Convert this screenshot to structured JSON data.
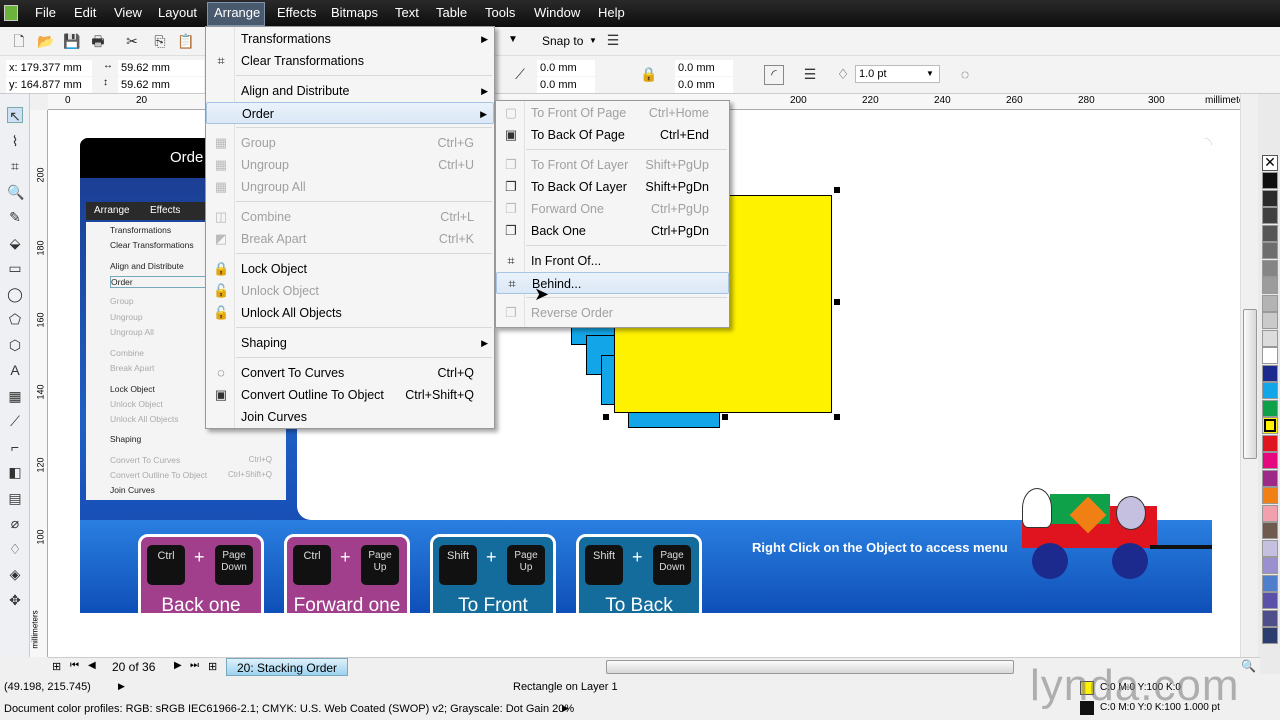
{
  "menubar": {
    "items": [
      "File",
      "Edit",
      "View",
      "Layout",
      "Arrange",
      "Effects",
      "Bitmaps",
      "Text",
      "Table",
      "Tools",
      "Window",
      "Help"
    ]
  },
  "toolbar": {
    "snap_to": "Snap to"
  },
  "property_bar": {
    "x": "x: 179.377 mm",
    "y": "y: 164.877 mm",
    "width": "59.62 mm",
    "height": "59.62 mm",
    "corner1": "0.0 mm",
    "corner2": "0.0 mm",
    "corner3": "0.0 mm",
    "corner4": "0.0 mm",
    "outline_width": "1.0 pt"
  },
  "ruler": {
    "h_ticks": [
      "0",
      "20",
      "200",
      "220",
      "240",
      "260",
      "280",
      "300"
    ],
    "unit": "millimeters",
    "v_ticks": [
      "200",
      "180",
      "160",
      "140",
      "120",
      "100"
    ],
    "v_unit": "millimeters"
  },
  "arrange_menu": [
    {
      "label": "Transformations",
      "arrow": true,
      "icon": ""
    },
    {
      "label": "Clear Transformations",
      "icon": "⌗"
    },
    {
      "sep": true
    },
    {
      "label": "Align and Distribute",
      "arrow": true
    },
    {
      "label": "Order",
      "arrow": true,
      "hl": true
    },
    {
      "sep": true
    },
    {
      "label": "Group",
      "shortcut": "Ctrl+G",
      "dis": true,
      "icon": "▦"
    },
    {
      "label": "Ungroup",
      "shortcut": "Ctrl+U",
      "dis": true,
      "icon": "▦"
    },
    {
      "label": "Ungroup All",
      "dis": true,
      "icon": "▦"
    },
    {
      "sep": true
    },
    {
      "label": "Combine",
      "shortcut": "Ctrl+L",
      "dis": true,
      "icon": "◫"
    },
    {
      "label": "Break Apart",
      "shortcut": "Ctrl+K",
      "dis": true,
      "icon": "◩"
    },
    {
      "sep": true
    },
    {
      "label": "Lock Object",
      "icon": "🔒"
    },
    {
      "label": "Unlock Object",
      "dis": true,
      "icon": "🔓"
    },
    {
      "label": "Unlock All Objects",
      "icon": "🔓"
    },
    {
      "sep": true
    },
    {
      "label": "Shaping",
      "arrow": true
    },
    {
      "sep": true
    },
    {
      "label": "Convert To Curves",
      "shortcut": "Ctrl+Q",
      "icon": "◌"
    },
    {
      "label": "Convert Outline To Object",
      "shortcut": "Ctrl+Shift+Q",
      "icon": "▣"
    },
    {
      "label": "Join Curves"
    }
  ],
  "order_menu": [
    {
      "label": "To Front Of Page",
      "shortcut": "Ctrl+Home",
      "dis": true,
      "icon": "▢"
    },
    {
      "label": "To Back Of Page",
      "shortcut": "Ctrl+End",
      "icon": "▣"
    },
    {
      "sep": true
    },
    {
      "label": "To Front Of Layer",
      "shortcut": "Shift+PgUp",
      "dis": true,
      "icon": "❐"
    },
    {
      "label": "To Back Of Layer",
      "shortcut": "Shift+PgDn",
      "icon": "❐"
    },
    {
      "label": "Forward One",
      "shortcut": "Ctrl+PgUp",
      "dis": true,
      "icon": "❐"
    },
    {
      "label": "Back One",
      "shortcut": "Ctrl+PgDn",
      "icon": "❐"
    },
    {
      "sep": true
    },
    {
      "label": "In Front Of...",
      "icon": "⌗"
    },
    {
      "label": "Behind...",
      "hl": true,
      "icon": "⌗"
    },
    {
      "sep": true
    },
    {
      "label": "Reverse Order",
      "dis": true,
      "icon": "❐"
    }
  ],
  "slide": {
    "title": "Orde",
    "mini_menu_header": [
      "Arrange",
      "Effects"
    ],
    "mini_menu": [
      {
        "label": "Transformations"
      },
      {
        "label": "Clear Transformations"
      },
      {
        "label": "Align and Distribute"
      },
      {
        "label": "Order",
        "hl": true
      },
      {
        "label": "Group",
        "dis": true
      },
      {
        "label": "Ungroup",
        "dis": true
      },
      {
        "label": "Ungroup All",
        "dis": true
      },
      {
        "label": "Combine",
        "dis": true
      },
      {
        "label": "Break Apart",
        "dis": true
      },
      {
        "label": "Lock Object"
      },
      {
        "label": "Unlock Object",
        "dis": true
      },
      {
        "label": "Unlock All Objects",
        "dis": true
      },
      {
        "label": "Shaping"
      },
      {
        "label": "Convert To Curves",
        "shortcut": "Ctrl+Q",
        "dis": true
      },
      {
        "label": "Convert Outline To Object",
        "shortcut": "Ctrl+Shift+Q",
        "dis": true
      },
      {
        "label": "Join Curves"
      }
    ],
    "keys": [
      {
        "k1": "Ctrl",
        "k2": "Page Down",
        "name": "Back one",
        "color": "#a23f8c"
      },
      {
        "k1": "Ctrl",
        "k2": "Page Up",
        "name": "Forward one",
        "color": "#a23f8c"
      },
      {
        "k1": "Shift",
        "k2": "Page Up",
        "name": "To Front",
        "color": "#146c9c"
      },
      {
        "k1": "Shift",
        "k2": "Page Down",
        "name": "To Back",
        "color": "#146c9c"
      }
    ],
    "hint": "Right Click on the Object to access menu"
  },
  "page_nav": {
    "counter": "20 of 36",
    "tab": "20: Stacking Order"
  },
  "status": {
    "coords": "(49.198, 215.745)",
    "object": "Rectangle on Layer 1",
    "profiles": "Document color profiles: RGB: sRGB IEC61966-2.1; CMYK: U.S. Web Coated (SWOP) v2; Grayscale: Dot Gain 20%",
    "fill": "C:0 M:0 Y:100 K:0",
    "outline": "C:0 M:0 Y:0 K:100  1.000 pt",
    "watermark": "lynda.com"
  },
  "palette": [
    "#101010",
    "#2b2b2b",
    "#404040",
    "#565656",
    "#6d6d6d",
    "#858585",
    "#9c9c9c",
    "#b3b3b3",
    "#cacaca",
    "#dcdcdc",
    "#ffffff",
    "#1b2a8c",
    "#12a6e8",
    "#0fa04a",
    "#fff200",
    "#e0141e",
    "#e5097f",
    "#9c2a86",
    "#f07f14",
    "#f2a0ae",
    "#6e5a4f",
    "#c5bfe0",
    "#9a8fcf",
    "#4f7fcc",
    "#5a52a8",
    "#4e4e8a",
    "#2d3e6e"
  ],
  "colors": {
    "accent": "#fff200",
    "selection_blue": "#12a6e8"
  }
}
